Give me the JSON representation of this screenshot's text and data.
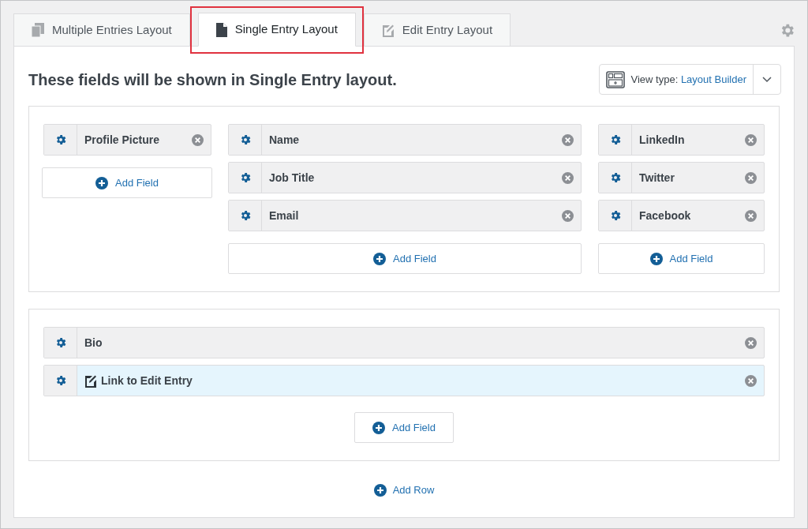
{
  "tabs": [
    {
      "label": "Multiple Entries Layout",
      "kind": "copies",
      "selected": false,
      "annotated": false
    },
    {
      "label": "Single Entry Layout",
      "kind": "page",
      "selected": true,
      "annotated": true
    },
    {
      "label": "Edit Entry Layout",
      "kind": "edit",
      "selected": false,
      "annotated": false
    }
  ],
  "heading": "These fields will be shown in Single Entry layout.",
  "view_type": {
    "label": "View type:",
    "value": "Layout Builder"
  },
  "rows": [
    {
      "columns": [
        {
          "fields": [
            {
              "kind": "field",
              "label": "Profile Picture"
            }
          ],
          "add_label": "Add Field"
        },
        {
          "fields": [
            {
              "kind": "field",
              "label": "Name"
            },
            {
              "kind": "field",
              "label": "Job Title"
            },
            {
              "kind": "field",
              "label": "Email"
            }
          ],
          "add_label": "Add Field"
        },
        {
          "fields": [
            {
              "kind": "field",
              "label": "LinkedIn"
            },
            {
              "kind": "field",
              "label": "Twitter"
            },
            {
              "kind": "field",
              "label": "Facebook"
            }
          ],
          "add_label": "Add Field"
        }
      ]
    },
    {
      "columns": [
        {
          "fields": [
            {
              "kind": "field",
              "label": "Bio"
            },
            {
              "kind": "edit-link",
              "label": "Link to Edit Entry"
            }
          ],
          "add_label": "Add Field"
        }
      ]
    }
  ],
  "add_row": "Add Row"
}
